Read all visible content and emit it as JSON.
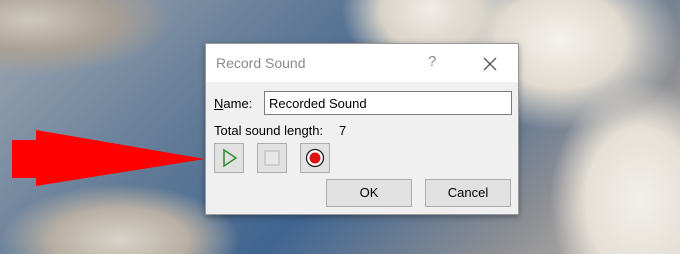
{
  "dialog": {
    "title": "Record Sound",
    "help_label": "?",
    "name_label_first": "N",
    "name_label_rest": "ame:",
    "name_value": "Recorded Sound",
    "length_label": "Total sound length:",
    "length_value": "7",
    "ok_label": "OK",
    "cancel_label": "Cancel"
  },
  "icons": {
    "play": "play-icon",
    "stop": "stop-icon",
    "record": "record-icon",
    "arrow": "red-arrow-icon"
  },
  "colors": {
    "arrow": "#ff0000",
    "play": "#2e8b2e",
    "record": "#e01010"
  }
}
